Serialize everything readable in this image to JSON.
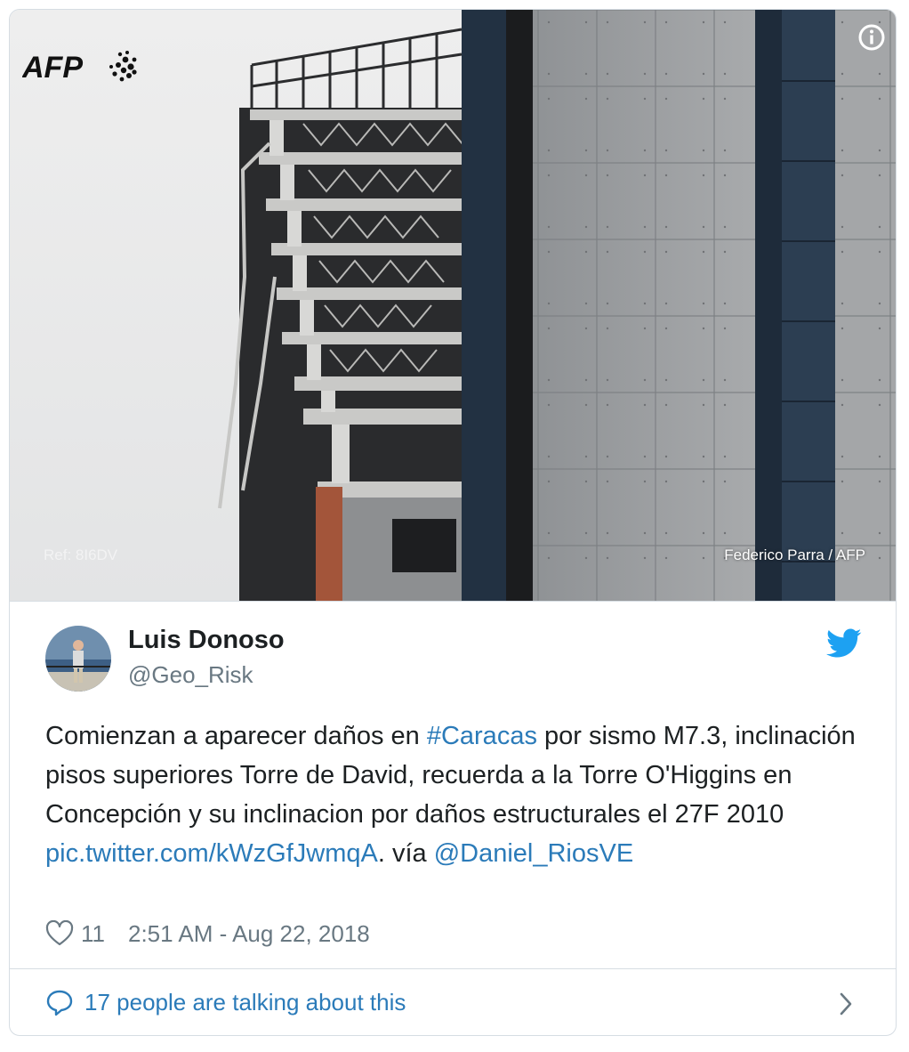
{
  "photo": {
    "agency_logo_text": "AFP",
    "ref": "Ref: 8I6DV",
    "credit": "Federico Parra / AFP",
    "info_icon": "info-icon"
  },
  "author": {
    "display_name": "Luis Donoso",
    "handle": "@Geo_Risk",
    "avatar_icon": "avatar"
  },
  "tweet": {
    "part1": "Comienzan a aparecer daños en ",
    "hashtag": "#Caracas",
    "part2": " por sismo M7.3, inclinación pisos superiores Torre de David, recuerda a la Torre O'Higgins en Concepción y su inclinacion por daños estructurales el 27F 2010 ",
    "link": "pic.twitter.com/kWzGfJwmqA",
    "part3": ". vía ",
    "mention": "@Daniel_RiosVE"
  },
  "meta": {
    "like_count": "11",
    "timestamp": "2:51 AM - Aug 22, 2018"
  },
  "footer": {
    "talking_text": "17 people are talking about this"
  },
  "colors": {
    "link": "#2b7bb9",
    "text": "#1c2022",
    "muted": "#697882",
    "twitter_blue": "#1da1f2"
  }
}
